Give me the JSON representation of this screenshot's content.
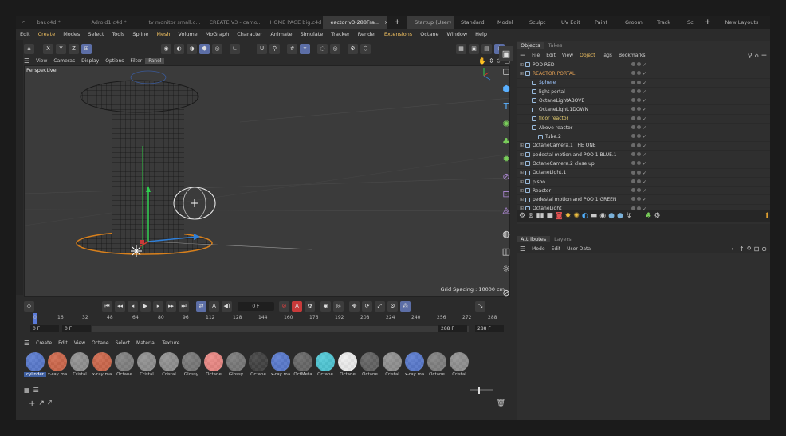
{
  "tabs": [
    {
      "label": "bar.c4d *",
      "active": false
    },
    {
      "label": "Adroid1.c4d *",
      "active": false
    },
    {
      "label": "tv monitor small.c...",
      "active": false
    },
    {
      "label": "CREATE V3 - camo...",
      "active": false
    },
    {
      "label": "HOME PAGE big.c4d",
      "active": false
    },
    {
      "label": "eactor v3-288Fra...",
      "active": true
    }
  ],
  "layouts": [
    "Startup (User)",
    "Standard",
    "Model",
    "Sculpt",
    "UV Edit",
    "Paint",
    "Groom",
    "Track",
    "Sc"
  ],
  "new_layouts": "New Layouts",
  "menu": [
    "Edit",
    "Create",
    "Modes",
    "Select",
    "Tools",
    "Spline",
    "Mesh",
    "Volume",
    "MoGraph",
    "Character",
    "Animate",
    "Simulate",
    "Tracker",
    "Render",
    "Extensions",
    "Octane",
    "Window",
    "Help"
  ],
  "toolbar": {
    "x": "X",
    "y": "Y",
    "z": "Z"
  },
  "viewport_menu": [
    "View",
    "Cameras",
    "Display",
    "Options",
    "Filter",
    "Panel"
  ],
  "viewport": {
    "label": "Perspective",
    "grid_spacing": "Grid Spacing : 10000 cm"
  },
  "timeline": {
    "current_frame": "0 F",
    "ticks": [
      "0",
      "16",
      "32",
      "48",
      "64",
      "80",
      "96",
      "112",
      "128",
      "144",
      "160",
      "176",
      "192",
      "208",
      "224",
      "240",
      "256",
      "272",
      "288"
    ],
    "start": "0 F",
    "start2": "0 F",
    "end": "288 F",
    "end2": "288 F"
  },
  "material_menu": [
    "Create",
    "Edit",
    "View",
    "Octane",
    "Select",
    "Material",
    "Texture"
  ],
  "materials": [
    {
      "label": "cylinder",
      "color": "#4a6fcf",
      "selected": true
    },
    {
      "label": "x-ray ma",
      "color": "#d05a3a"
    },
    {
      "label": "Cristal",
      "color": "#8a8a8a"
    },
    {
      "label": "x-ray ma",
      "color": "#d05a3a"
    },
    {
      "label": "Octane",
      "color": "#777777"
    },
    {
      "label": "Cristal",
      "color": "#8a8a8a"
    },
    {
      "label": "Cristal",
      "color": "#8a8a8a"
    },
    {
      "label": "Glossy",
      "color": "#6e6e6e"
    },
    {
      "label": "Octane",
      "color": "#f0807a"
    },
    {
      "label": "Glossy",
      "color": "#6e6e6e"
    },
    {
      "label": "Octane",
      "color": "#2e2e2e"
    },
    {
      "label": "x-ray ma",
      "color": "#4a6fcf"
    },
    {
      "label": "OctMeta",
      "color": "#5a5a5a"
    },
    {
      "label": "Octane",
      "color": "#3ec8d8"
    },
    {
      "label": "Octane",
      "color": "#f4f4f4"
    },
    {
      "label": "Octane",
      "color": "#555555"
    },
    {
      "label": "Cristal",
      "color": "#8a8a8a"
    },
    {
      "label": "x-ray ma",
      "color": "#4a6fcf"
    },
    {
      "label": "Octane",
      "color": "#777777"
    },
    {
      "label": "Cristal",
      "color": "#8a8a8a"
    }
  ],
  "objects_panel": {
    "tabs": [
      "Objects",
      "Takes"
    ],
    "menu": [
      "File",
      "Edit",
      "View",
      "Object",
      "Tags",
      "Bookmarks"
    ],
    "items": [
      {
        "name": "POD RED",
        "indent": 0,
        "color": "normal"
      },
      {
        "name": "REACTOR PORTAL",
        "indent": 0,
        "color": "orange"
      },
      {
        "name": "Sphere",
        "indent": 1,
        "color": "blue"
      },
      {
        "name": "light portal",
        "indent": 1,
        "color": "normal"
      },
      {
        "name": "OctaneLightABOVE",
        "indent": 1,
        "color": "normal"
      },
      {
        "name": "OctaneLight.1DOWN",
        "indent": 1,
        "color": "normal"
      },
      {
        "name": "floor reactor",
        "indent": 1,
        "color": "yellow"
      },
      {
        "name": "Above reactor",
        "indent": 1,
        "color": "normal"
      },
      {
        "name": "Tube.2",
        "indent": 2,
        "color": "normal"
      },
      {
        "name": "OctaneCamera.1 THE ONE",
        "indent": 0,
        "color": "normal"
      },
      {
        "name": "pedestal motion and POO 1 BLUE.1",
        "indent": 0,
        "color": "normal"
      },
      {
        "name": "OctaneCamera.2 close up",
        "indent": 0,
        "color": "normal"
      },
      {
        "name": "OctaneLight.1",
        "indent": 0,
        "color": "normal"
      },
      {
        "name": "pisoo",
        "indent": 0,
        "color": "normal"
      },
      {
        "name": "Reactor",
        "indent": 0,
        "color": "normal"
      },
      {
        "name": "pedestal motion and POO 1 GREEN",
        "indent": 0,
        "color": "normal"
      },
      {
        "name": "OctaneLight",
        "indent": 0,
        "color": "normal"
      }
    ]
  },
  "attributes_panel": {
    "tabs": [
      "Attributes",
      "Layers"
    ],
    "menu": [
      "Mode",
      "Edit",
      "User Data"
    ]
  }
}
